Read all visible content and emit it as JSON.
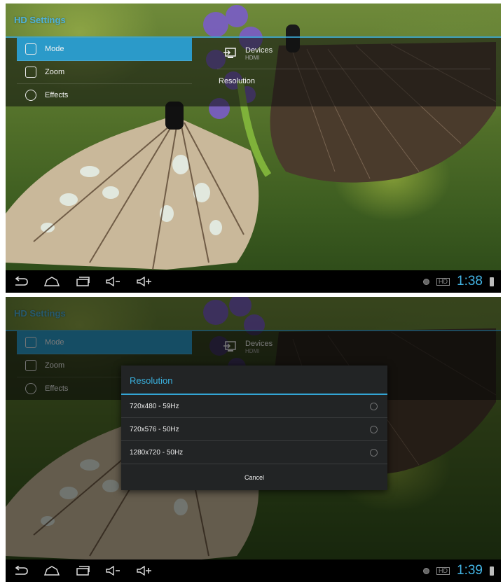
{
  "top_screen": {
    "app_title": "HD Settings",
    "menu": [
      {
        "label": "Mode",
        "icon": "mode-icon",
        "selected": true
      },
      {
        "label": "Zoom",
        "icon": "zoom-icon",
        "selected": false
      },
      {
        "label": "Effects",
        "icon": "effects-icon",
        "selected": false
      }
    ],
    "devices_label": "Devices",
    "devices_sub": "HDMI",
    "resolution_label": "Resolution",
    "status": {
      "hd_label": "HD",
      "time": "1:38"
    }
  },
  "bottom_screen": {
    "app_title": "HD Settings",
    "menu": [
      {
        "label": "Mode",
        "icon": "mode-icon",
        "selected": true
      },
      {
        "label": "Zoom",
        "icon": "zoom-icon",
        "selected": false
      },
      {
        "label": "Effects",
        "icon": "effects-icon",
        "selected": false
      }
    ],
    "devices_label": "Devices",
    "devices_sub": "HDMI",
    "dialog": {
      "title": "Resolution",
      "options": [
        "720x480 - 59Hz",
        "720x576 - 50Hz",
        "1280x720 - 50Hz"
      ],
      "cancel_label": "Cancel"
    },
    "status": {
      "hd_label": "HD",
      "time": "1:39"
    }
  },
  "nav_icons": [
    "back-icon",
    "home-icon",
    "recents-icon",
    "volume-down-icon",
    "volume-up-icon"
  ],
  "colors": {
    "accent": "#3aa6d3",
    "clock": "#43b4e4"
  }
}
